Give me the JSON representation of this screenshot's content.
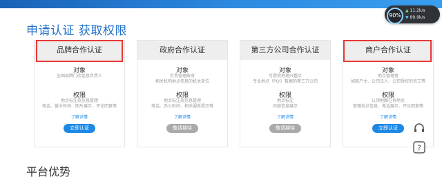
{
  "header": {
    "title": "申请认证 获取权限"
  },
  "section2": {
    "title": "平台优势"
  },
  "widget": {
    "percent": "90%",
    "upload": "11.2k/s",
    "download": "89.9k/s"
  },
  "cards": [
    {
      "title": "品牌合作认证",
      "obj_label": "对象",
      "obj_desc": "全国品牌门店信息负责人",
      "perm_label": "权限",
      "perm_desc1": "地点标注及信息管理",
      "perm_desc2": "电话、营业时间、图片展示、评论回复等",
      "more": "了解详情",
      "button": "立即认证"
    },
    {
      "title": "政府合作认证",
      "obj_label": "对象",
      "obj_desc": "负责管理政府",
      "obj_desc2": "相关机构地点信息的机关单位",
      "perm_label": "权限",
      "perm_desc1": "地点标注及信息管理",
      "perm_desc2": "电话、办公时间、相关服务提示等",
      "more": "了解详情",
      "button": "敬请期待"
    },
    {
      "title": "第三方公司合作认证",
      "obj_label": "对象",
      "obj_desc": "可提供地理兴趣点",
      "obj_desc2": "专业地点（POI）数据的第三方公司",
      "perm_label": "权限",
      "perm_desc1": "地点标注",
      "perm_desc2": "内容信息展示",
      "more": "了解详情",
      "button": "敬请期待"
    },
    {
      "title": "商户合作认证",
      "obj_label": "对象",
      "obj_desc": "地点管理者",
      "obj_desc2": "如商户主、公司法人、公司授权的员工等",
      "perm_label": "权限",
      "perm_desc1": "认领地图已有地点",
      "perm_desc2": "管理地点信息、电话展示、评论回复等",
      "more": "了解详情",
      "button": "立即认证"
    }
  ]
}
